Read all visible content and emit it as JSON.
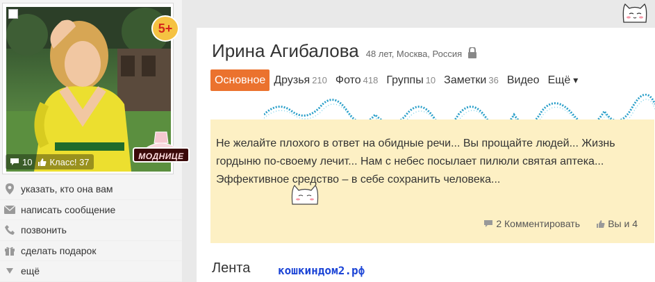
{
  "profile": {
    "name": "Ирина Агибалова",
    "meta": "48 лет, Москва, Россия",
    "age_badge": "5+",
    "sticker_label": "МОДНИЦЕ",
    "comments_count": "10",
    "class_label": "Класс! 37"
  },
  "tabs": [
    {
      "label": "Основное",
      "count": ""
    },
    {
      "label": "Друзья",
      "count": "210"
    },
    {
      "label": "Фото",
      "count": "418"
    },
    {
      "label": "Группы",
      "count": "10"
    },
    {
      "label": "Заметки",
      "count": "36"
    },
    {
      "label": "Видео",
      "count": ""
    },
    {
      "label": "Ещё",
      "count": ""
    }
  ],
  "actions": [
    {
      "label": "указать, кто она вам",
      "icon": "location-pin-icon"
    },
    {
      "label": "написать сообщение",
      "icon": "envelope-icon"
    },
    {
      "label": "позвонить",
      "icon": "phone-icon"
    },
    {
      "label": "сделать подарок",
      "icon": "gift-icon"
    },
    {
      "label": "ещё",
      "icon": "triangle-down-icon"
    }
  ],
  "status": {
    "text": "Не желайте плохого в ответ на обидные речи... Вы прощайте людей... Жизнь гордыню по-своему лечит... Нам с небес посылает пилюли святая аптека... Эффективное средство – в себе сохранить человека...",
    "comment_link": "2 Комментировать",
    "like_link": "Вы и 4"
  },
  "feed_title": "Лента",
  "watermark": "кошкиндом2.рф",
  "colors": {
    "accent": "#eb722e",
    "note_bg": "#fdf0c4",
    "watermark": "#1b44d6"
  }
}
